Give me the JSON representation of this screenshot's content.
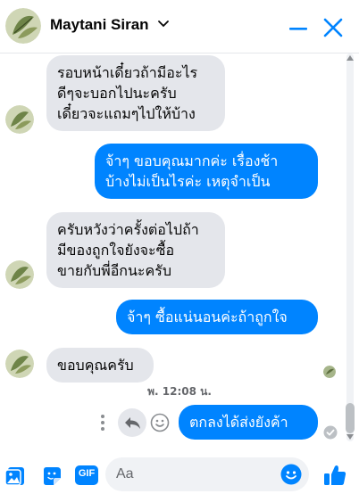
{
  "header": {
    "contact_name": "Maytani Siran"
  },
  "messages": [
    {
      "direction": "in",
      "lines": [
        "รอบหน้าเดี๋ยวถ้ามีอะไร",
        "ดีๆจะบอกไปนะครับ",
        "เดี๋ยวจะแถมๆไปให้บ้าง"
      ]
    },
    {
      "direction": "out",
      "lines": [
        "จ้าๆ ขอบคุณมากค่ะ เรื่องช้า",
        "บ้างไม่เป็นไรค่ะ เหตุจำเป็น"
      ]
    },
    {
      "direction": "in",
      "lines": [
        "ครับหวังว่าครั้งต่อไปถ้า",
        "มีของถูกใจยังจะซื้อ",
        "ขายกับพี่อีกนะครับ"
      ]
    },
    {
      "direction": "out",
      "lines": [
        "จ้าๆ ซื้อแน่นอนค่ะถ้าถูกใจ"
      ]
    },
    {
      "direction": "in",
      "lines": [
        "ขอบคุณครับ"
      ]
    },
    {
      "direction": "out",
      "lines": [
        "ตกลงได้ส่งยังค้า"
      ]
    }
  ],
  "timestamp": "พ. 12:08 น.",
  "composer": {
    "placeholder": "Aa",
    "gif_label": "GIF"
  },
  "colors": {
    "accent": "#0084ff",
    "incoming_bubble": "#e4e6eb",
    "secondary_text": "#65676b"
  }
}
